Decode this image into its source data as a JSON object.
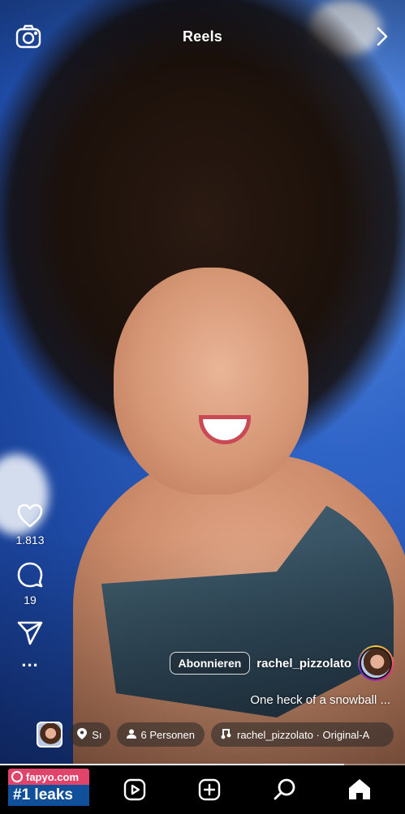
{
  "header": {
    "title": "Reels"
  },
  "icons": {
    "camera": "camera-icon",
    "chevron": "chevron-right-icon",
    "like": "heart-icon",
    "comment": "comment-icon",
    "share": "send-icon",
    "more": "more-icon"
  },
  "actions": {
    "likes": "1.813",
    "comments": "19",
    "more": "..."
  },
  "post": {
    "username": "rachel_pizzolato",
    "follow_label": "Abonnieren",
    "caption": "One heck of a snowball ..."
  },
  "chips": {
    "audio": "rachel_pizzolato · Original-A",
    "people": "6 Personen",
    "location": "Sı"
  },
  "progress": 0.85,
  "watermark": {
    "top": "fapyo.com",
    "bottom": "#1 leaks"
  },
  "nav": [
    "reels-icon",
    "create-icon",
    "search-icon",
    "home-icon"
  ]
}
